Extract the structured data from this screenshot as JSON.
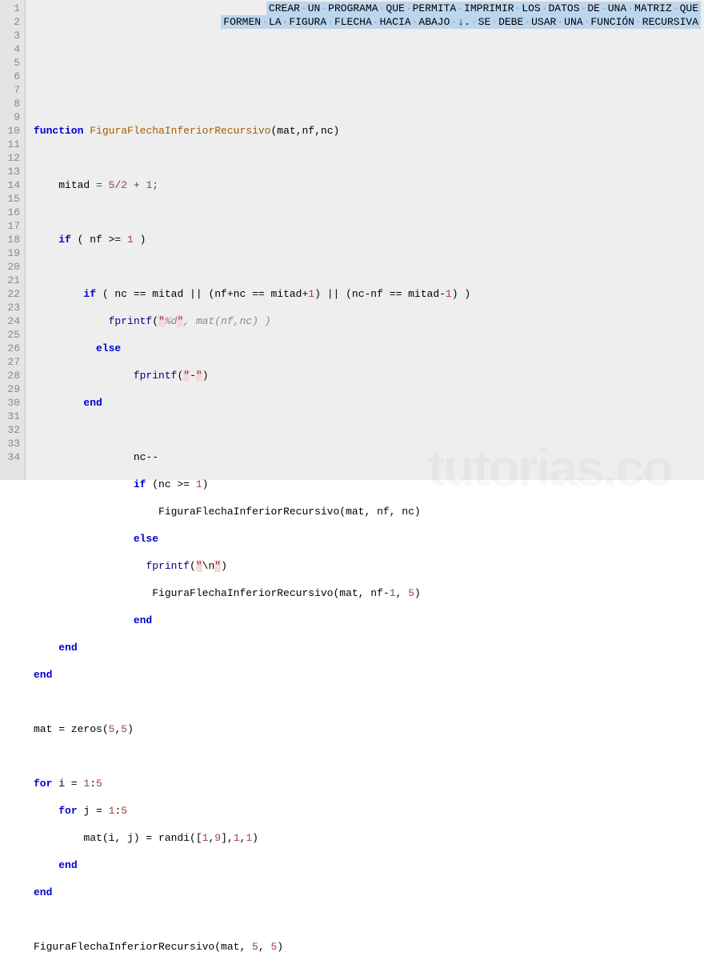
{
  "lines": {
    "count": 34,
    "comment1_words": [
      "CREAR",
      "UN",
      "PROGRAMA",
      "QUE",
      "PERMITA",
      "IMPRIMIR",
      "LOS",
      "DATOS",
      "DE",
      "UNA",
      "MATRIZ",
      "QUE"
    ],
    "comment2_words": [
      "FORMEN",
      "LA",
      "FIGURA",
      "FLECHA",
      "HACIA",
      "ABAJO",
      "↓.",
      "SE",
      "DEBE",
      "USAR",
      "UNA",
      "FUNCIÓN",
      "RECURSIVA"
    ]
  },
  "code": {
    "l4_function": "function",
    "l4_name": "FiguraFlechaInferiorRecursivo",
    "l4_args": "(mat,nf,nc)",
    "l6_mitad": "mitad",
    "l6_eq": " = ",
    "l6_expr_5": "5",
    "l6_slash": "/",
    "l6_expr_2": "2",
    "l6_plus": " + ",
    "l6_expr_1": "1",
    "l6_semi": ";",
    "l8_if": "if",
    "l8_cond": " ( nf >= ",
    "l8_1": "1",
    "l8_close": " )",
    "l10_if": "if",
    "l10_a": " ( nc == mitad || (nf+nc == mitad+",
    "l10_1a": "1",
    "l10_b": ") || (nc-nf == mitad-",
    "l10_1b": "1",
    "l10_c": ") )",
    "l11_fprintf": "fprintf",
    "l11_open": "(",
    "l11_q1": "\"",
    "l11_fmt": "%d",
    "l11_q2": "\"",
    "l11_rest": ", mat(nf,nc) )",
    "l12_else": "else",
    "l13_fprintf": "fprintf",
    "l13_open": "(",
    "l13_q1": "\"",
    "l13_dash": "-",
    "l13_q2": "\"",
    "l13_close": ")",
    "l14_end": "end",
    "l16_ncdec": "nc--",
    "l17_if": "if",
    "l17_a": " (nc >= ",
    "l17_1": "1",
    "l17_b": ")",
    "l18_call": "FiguraFlechaInferiorRecursivo(mat, nf, nc)",
    "l19_else": "else",
    "l20_fprintf": "fprintf",
    "l20_open": "(",
    "l20_q1": "\"",
    "l20_bs": "\\n",
    "l20_q2": "\"",
    "l20_close": ")",
    "l21_call_a": "FiguraFlechaInferiorRecursivo(mat, nf-",
    "l21_1": "1",
    "l21_call_b": ", ",
    "l21_5": "5",
    "l21_call_c": ")",
    "l22_end": "end",
    "l23_end": "end",
    "l24_end": "end",
    "l26_mat": "mat = zeros(",
    "l26_5a": "5",
    "l26_comma": ",",
    "l26_5b": "5",
    "l26_close": ")",
    "l28_for": "for",
    "l28_a": " i = ",
    "l28_1": "1",
    "l28_colon": ":",
    "l28_5": "5",
    "l29_for": "for",
    "l29_a": " j = ",
    "l29_1": "1",
    "l29_colon": ":",
    "l29_5": "5",
    "l30_a": "mat(i, j) = randi([",
    "l30_1": "1",
    "l30_comma": ",",
    "l30_9": "9",
    "l30_b": "],",
    "l30_1b": "1",
    "l30_c": ",",
    "l30_1c": "1",
    "l30_d": ")",
    "l31_end": "end",
    "l32_end": "end",
    "l34_call_a": "FiguraFlechaInferiorRecursivo(mat, ",
    "l34_5a": "5",
    "l34_comma": ", ",
    "l34_5b": "5",
    "l34_close": ")"
  },
  "watermark": "tutorias.co"
}
